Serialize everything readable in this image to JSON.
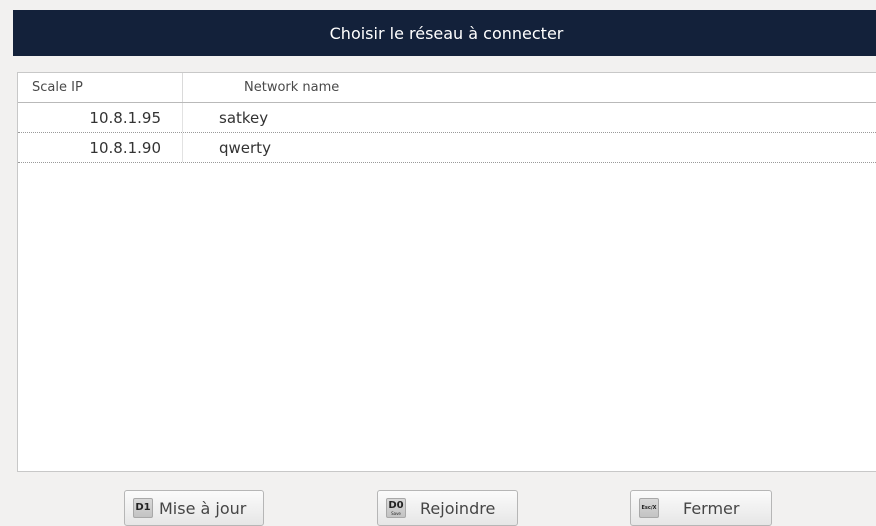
{
  "dialog": {
    "title": "Choisir le réseau à connecter"
  },
  "table": {
    "columns": {
      "scale_ip": "Scale IP",
      "network_name": "Network name"
    },
    "rows": [
      {
        "scale_ip": "10.8.1.95",
        "network_name": "satkey"
      },
      {
        "scale_ip": "10.8.1.90",
        "network_name": "qwerty"
      }
    ]
  },
  "footer": {
    "update": {
      "key": "D1",
      "label": "Mise à jour"
    },
    "join": {
      "key": "D0",
      "key_sub": "Save",
      "label": "Rejoindre"
    },
    "close": {
      "key": "Esc/X",
      "label": "Fermer"
    }
  },
  "colors": {
    "title_bar": "#13213a",
    "background": "#f2f1f0",
    "table_background": "#ffffff"
  }
}
